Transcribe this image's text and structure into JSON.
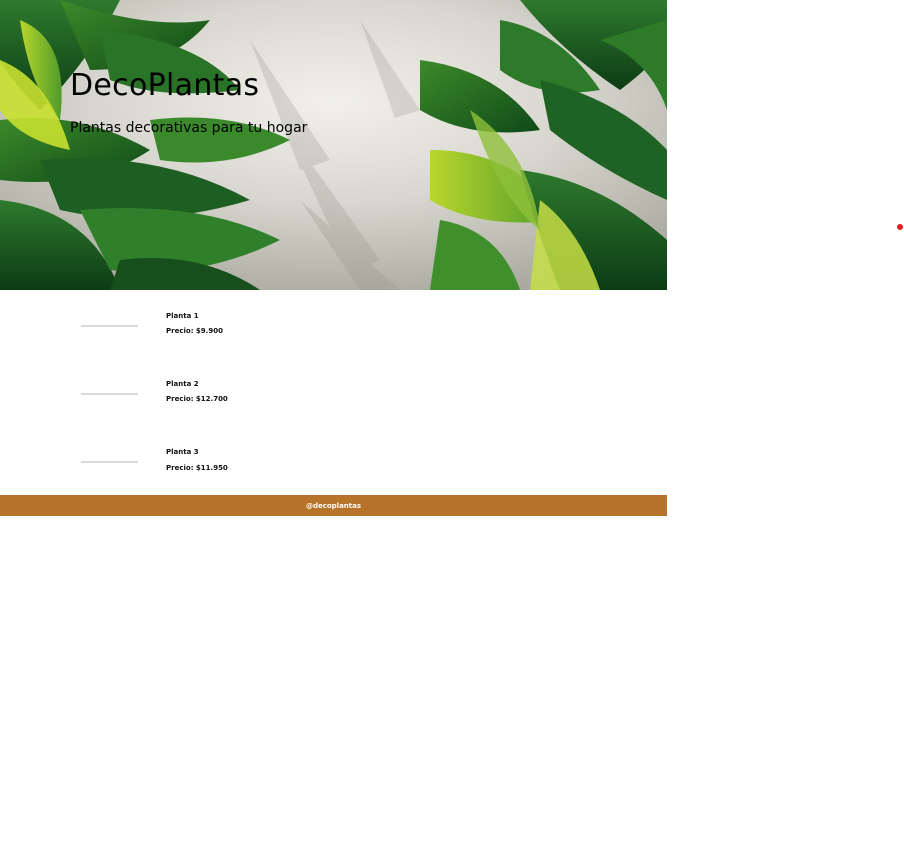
{
  "hero": {
    "title": "DecoPlantas",
    "subtitle": "Plantas decorativas para tu hogar",
    "image_icon": "tropical-palm-leaves-image"
  },
  "products": [
    {
      "name": "Planta 1",
      "price": "Precio: $9.900"
    },
    {
      "name": "Planta 2",
      "price": "Precio: $12.700"
    },
    {
      "name": "Planta 3",
      "price": "Precio: $11.950"
    }
  ],
  "footer": {
    "handle": "@decoplantas",
    "background_color": "#b8732a"
  },
  "colors": {
    "accent_dot": "#e02020"
  }
}
